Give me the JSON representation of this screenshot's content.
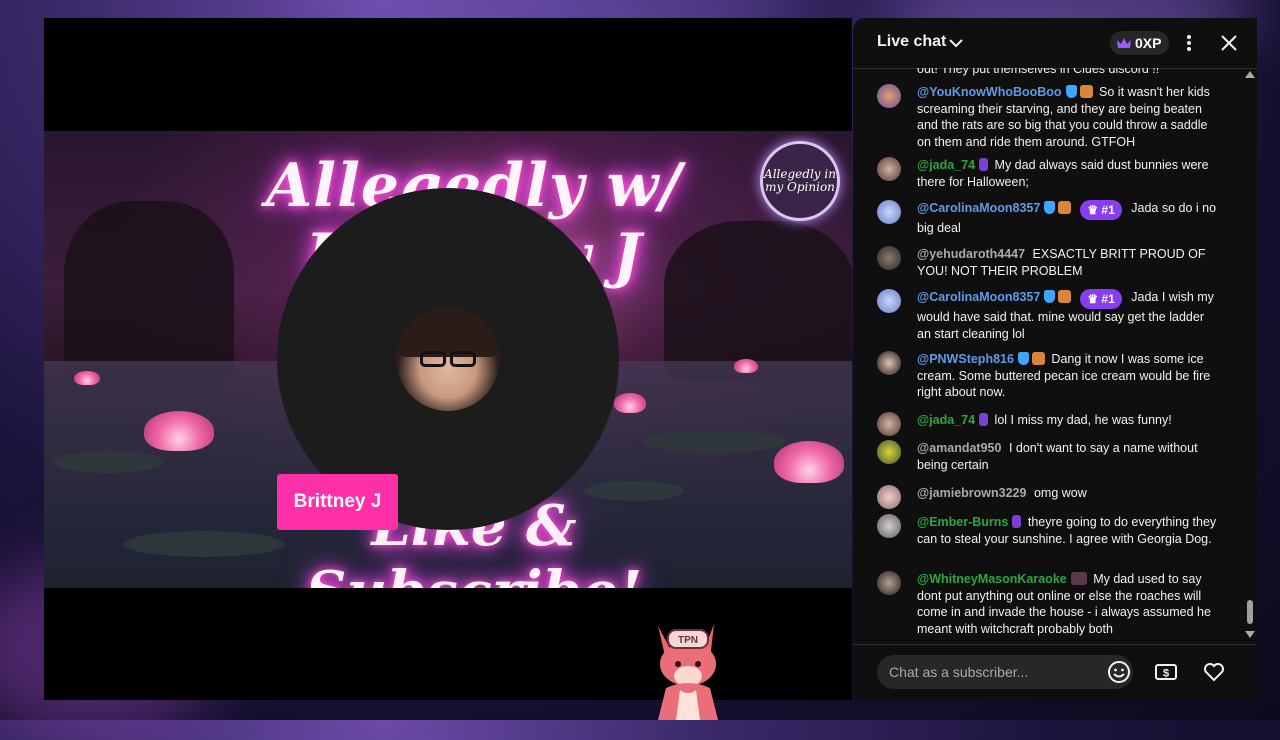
{
  "video": {
    "banner_title": "Allegedly w/ Brittney J",
    "banner_subtitle": "Like & Subscribe!",
    "logo_text": "Allegedly in my Opinion",
    "speaker_name": "Brittney J",
    "mascot_text": "TPN"
  },
  "chat": {
    "title": "Live chat",
    "xp": "0XP",
    "partial_top": "out! They put themselves in Clues discord !!",
    "input_placeholder": "Chat as a subscriber...",
    "messages": [
      {
        "author": "@YouKnowWhoBooBoo",
        "text": "So it wasn't her kids screaming their starving, and they are being beaten and the rats are so big that you could throw a saddle on them and ride them around. GTFOH"
      },
      {
        "author": "@jada_74",
        "text": "My dad always said dust bunnies were there for Halloween;"
      },
      {
        "author": "@CarolinaMoon8357",
        "rank": "#1",
        "text": "Jada so do i no big deal"
      },
      {
        "author": "@yehudaroth4447",
        "text": "EXSACTLY BRITT PROUD OF YOU! NOT THEIR PROBLEM"
      },
      {
        "author": "@CarolinaMoon8357",
        "rank": "#1",
        "text": "Jada I wish my would have said that. mine would say get the ladder an start cleaning lol"
      },
      {
        "author": "@PNWSteph816",
        "text": "Dang it now I was some ice cream. Some buttered pecan ice cream would be fire right about now."
      },
      {
        "author": "@jada_74",
        "text": "lol I miss my dad, he was funny!"
      },
      {
        "author": "@amandat950",
        "text": "I don't want to say a name without being certain"
      },
      {
        "author": "@jamiebrown3229",
        "text": "omg wow"
      },
      {
        "author": "@Ember-Burns",
        "text": "theyre going to do everything they can to steal your sunshine. I agree with Georgia Dog."
      },
      {
        "author": "@WhitneyMasonKaraoke",
        "text": "My dad used to say dont put anything out online or else the roaches will come in and invade the house - i always assumed he meant with witchcraft probably both"
      }
    ]
  },
  "colors": {
    "moderator_name": "#5e9be8",
    "member_name": "#2ba640",
    "name_tag": "#ff2fa8",
    "rank_pill": "#8a3cf0"
  },
  "icons": [
    "chevron-down-icon",
    "crown-icon",
    "more-vert-icon",
    "close-icon",
    "emoji-icon",
    "super-chat-icon",
    "heart-icon"
  ]
}
